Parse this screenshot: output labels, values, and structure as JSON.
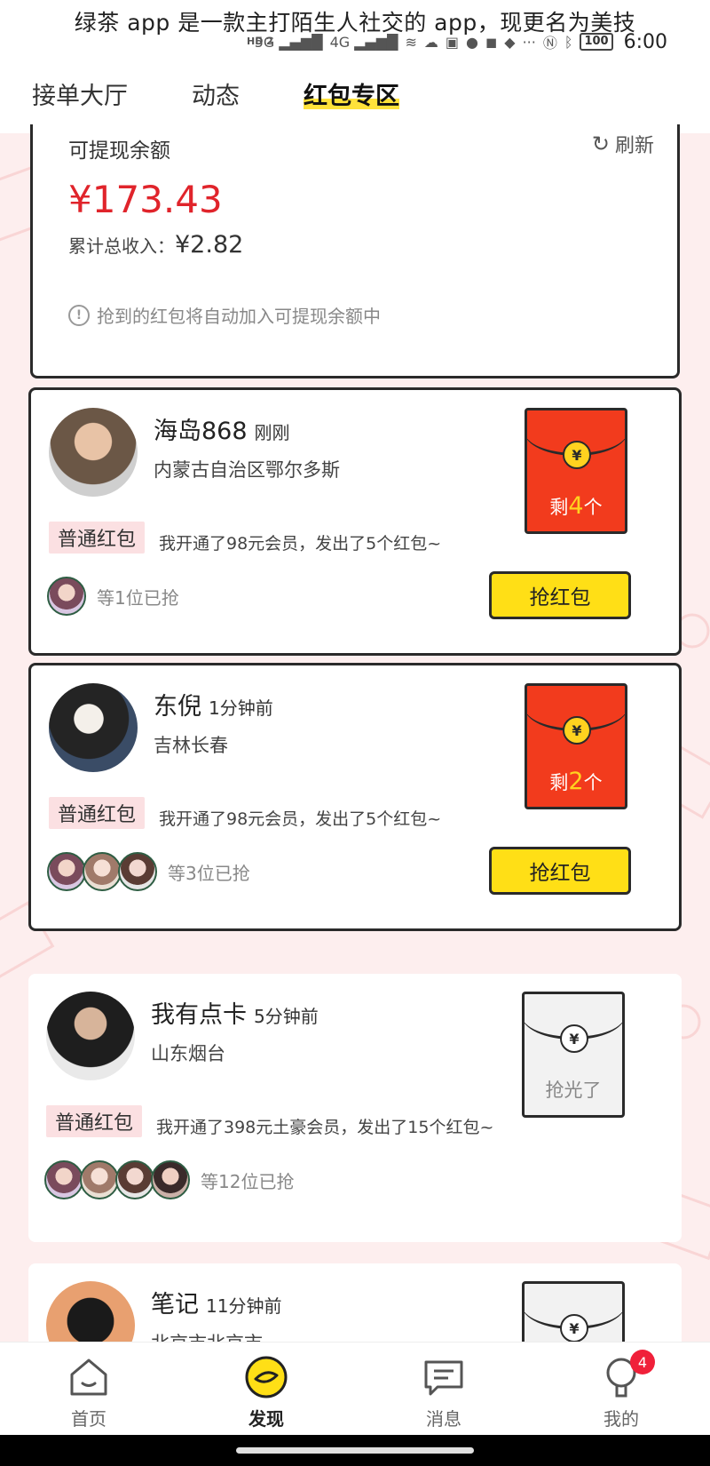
{
  "caption": "绿茶 app 是一款主打陌生人社交的 app，现更名为美技",
  "status_bar": {
    "hd_label": "HD 2",
    "network_1": "5G",
    "network_2": "4G",
    "battery": "100",
    "time": "6:00"
  },
  "tabs": [
    {
      "label": "接单大厅",
      "active": false
    },
    {
      "label": "动态",
      "active": false
    },
    {
      "label": "红包专区",
      "active": true
    }
  ],
  "balance": {
    "label": "可提现余额",
    "refresh_label": "刷新",
    "amount": "¥173.43",
    "total_label": "累计总收入：",
    "total_value": "¥2.82",
    "note": "抢到的红包将自动加入可提现余额中"
  },
  "posts": [
    {
      "name": "海岛868",
      "time": "刚刚",
      "location": "内蒙古自治区鄂尔多斯",
      "tag": "普通红包",
      "message": "我开通了98元会员，发出了5个红包~",
      "envelope_prefix": "剩",
      "remaining": "4",
      "envelope_suffix": "个",
      "grab_count": "等1位已抢",
      "button": "抢红包"
    },
    {
      "name": "东倪",
      "time": "1分钟前",
      "location": "吉林长春",
      "tag": "普通红包",
      "message": "我开通了98元会员，发出了5个红包~",
      "envelope_prefix": "剩",
      "remaining": "2",
      "envelope_suffix": "个",
      "grab_count": "等3位已抢",
      "button": "抢红包"
    },
    {
      "name": "我有点卡",
      "time": "5分钟前",
      "location": "山东烟台",
      "tag": "普通红包",
      "message": "我开通了398元土豪会员，发出了15个红包~",
      "envelope_status": "抢光了",
      "grab_count": "等12位已抢"
    },
    {
      "name": "笔记",
      "time": "11分钟前",
      "location": "北京市北京市"
    }
  ],
  "bottom_tabs": [
    {
      "label": "首页",
      "icon": "home-icon"
    },
    {
      "label": "发现",
      "icon": "discover-icon",
      "active": true
    },
    {
      "label": "消息",
      "icon": "message-icon"
    },
    {
      "label": "我的",
      "icon": "profile-icon",
      "badge": "4"
    }
  ],
  "colors": {
    "accent_yellow": "#ffdf16",
    "red_envelope": "#f23b1d",
    "amount_red": "#e0242b",
    "background_pink": "#fdeeee"
  }
}
